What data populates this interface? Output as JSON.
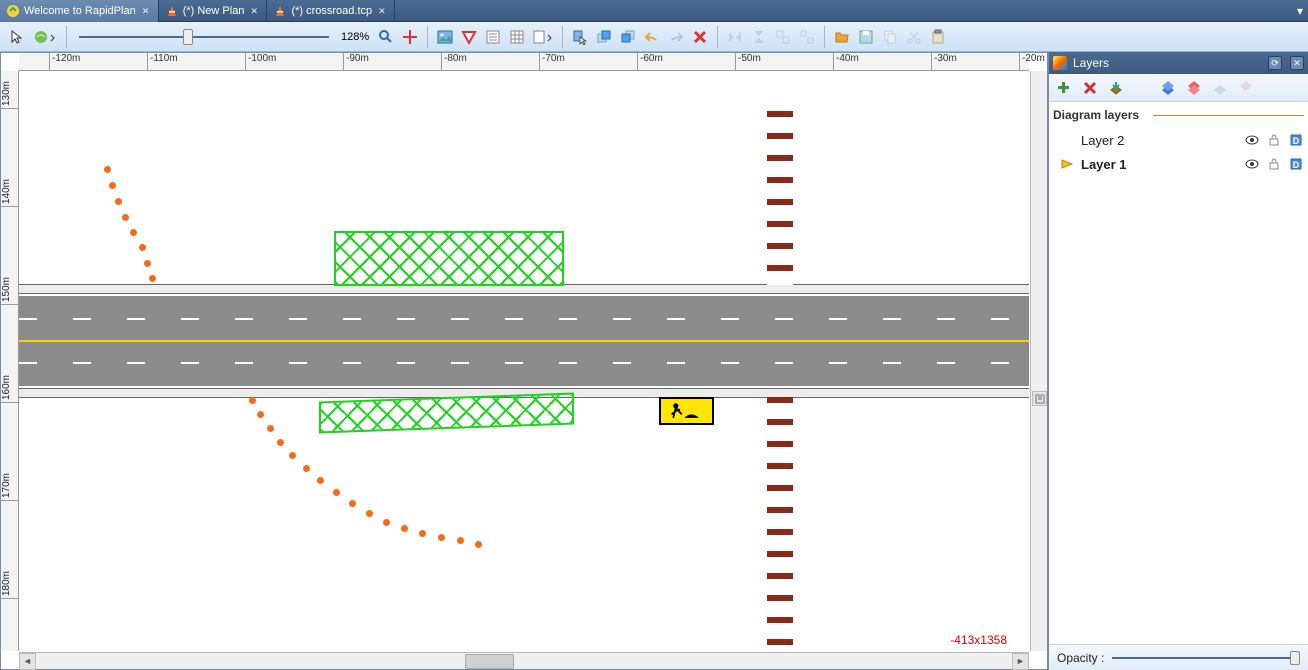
{
  "tabs": [
    {
      "label": "Welcome to RapidPlan",
      "active": true
    },
    {
      "label": "(*) New Plan",
      "active": false
    },
    {
      "label": "(*) crossroad.tcp",
      "active": false
    }
  ],
  "zoom": {
    "label": "128%"
  },
  "ruler_top": [
    "-120m",
    "-110m",
    "-100m",
    "-90m",
    "-80m",
    "-70m",
    "-60m",
    "-50m",
    "-40m",
    "-30m",
    "-20m"
  ],
  "ruler_left": [
    "130m",
    "140m",
    "150m",
    "160m",
    "170m",
    "180m"
  ],
  "status": {
    "dimensions": "-413x1358"
  },
  "scroll": {
    "thumb_left_pct": 44,
    "thumb_width_pct": 5
  },
  "palette": {
    "title": "Layers",
    "section": "Diagram layers",
    "layers": [
      {
        "name": "Layer 2",
        "active": false
      },
      {
        "name": "Layer 1",
        "active": true
      }
    ],
    "footer_label": "Opacity :"
  },
  "colors": {
    "accent": "#4a6b93"
  }
}
